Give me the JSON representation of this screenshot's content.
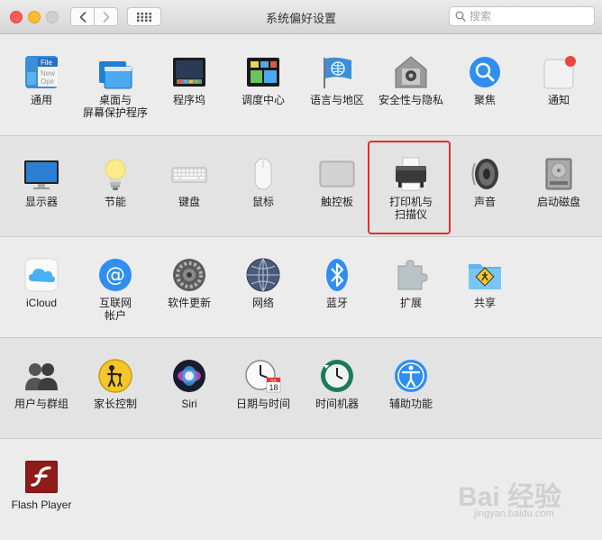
{
  "window": {
    "title": "系统偏好设置",
    "search_placeholder": "搜索"
  },
  "rows": [
    [
      {
        "label": "通用",
        "icon": "general-icon"
      },
      {
        "label": "桌面与\n屏幕保护程序",
        "icon": "desktop-screensaver-icon"
      },
      {
        "label": "程序坞",
        "icon": "dock-icon"
      },
      {
        "label": "调度中心",
        "icon": "mission-control-icon"
      },
      {
        "label": "语言与地区",
        "icon": "language-region-icon"
      },
      {
        "label": "安全性与隐私",
        "icon": "security-privacy-icon"
      },
      {
        "label": "聚焦",
        "icon": "spotlight-icon"
      },
      {
        "label": "通知",
        "icon": "notifications-icon"
      }
    ],
    [
      {
        "label": "显示器",
        "icon": "displays-icon"
      },
      {
        "label": "节能",
        "icon": "energy-saver-icon"
      },
      {
        "label": "键盘",
        "icon": "keyboard-icon"
      },
      {
        "label": "鼠标",
        "icon": "mouse-icon"
      },
      {
        "label": "触控板",
        "icon": "trackpad-icon"
      },
      {
        "label": "打印机与\n扫描仪",
        "icon": "printers-scanners-icon"
      },
      {
        "label": "声音",
        "icon": "sound-icon"
      },
      {
        "label": "启动磁盘",
        "icon": "startup-disk-icon"
      }
    ],
    [
      {
        "label": "iCloud",
        "icon": "icloud-icon"
      },
      {
        "label": "互联网\n帐户",
        "icon": "internet-accounts-icon"
      },
      {
        "label": "软件更新",
        "icon": "software-update-icon"
      },
      {
        "label": "网络",
        "icon": "network-icon"
      },
      {
        "label": "蓝牙",
        "icon": "bluetooth-icon"
      },
      {
        "label": "扩展",
        "icon": "extensions-icon"
      },
      {
        "label": "共享",
        "icon": "sharing-icon"
      }
    ],
    [
      {
        "label": "用户与群组",
        "icon": "users-groups-icon"
      },
      {
        "label": "家长控制",
        "icon": "parental-controls-icon"
      },
      {
        "label": "Siri",
        "icon": "siri-icon"
      },
      {
        "label": "日期与时间",
        "icon": "date-time-icon"
      },
      {
        "label": "时间机器",
        "icon": "time-machine-icon"
      },
      {
        "label": "辅助功能",
        "icon": "accessibility-icon"
      }
    ],
    [
      {
        "label": "Flash Player",
        "icon": "flash-player-icon"
      }
    ]
  ],
  "icon_text": {
    "general_file": "File",
    "general_new": "New",
    "general_ope": "Ope",
    "calendar_month": "JUL",
    "calendar_day": "18"
  },
  "watermark": {
    "logo": "Bai 经验",
    "url": "jingyan.baidu.com"
  },
  "colors": {
    "highlight": "#e0302d",
    "close": "#fc5b57",
    "minimize": "#fdbc2e"
  }
}
